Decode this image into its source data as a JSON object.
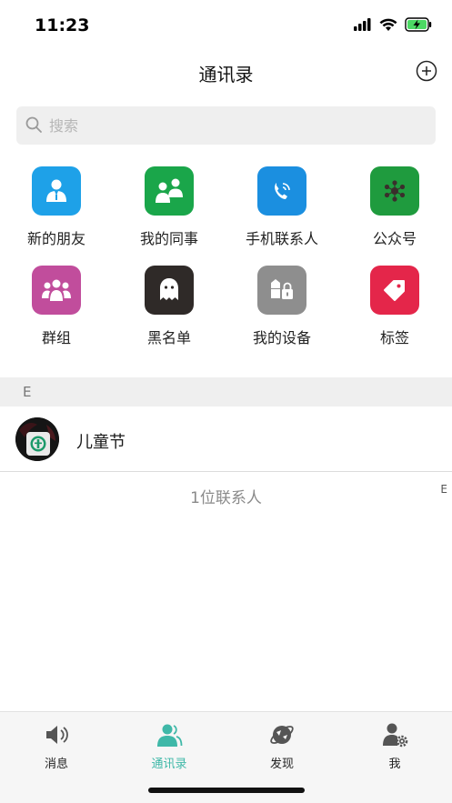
{
  "status": {
    "time": "11:23"
  },
  "header": {
    "title": "通讯录",
    "add_icon": "plus-circle-icon"
  },
  "search": {
    "placeholder": "搜索"
  },
  "grid": [
    {
      "label": "新的朋友",
      "color": "#1ea1e8",
      "icon": "new-friend-icon"
    },
    {
      "label": "我的同事",
      "color": "#1aa64a",
      "icon": "colleagues-icon"
    },
    {
      "label": "手机联系人",
      "color": "#1b8fe0",
      "icon": "phone-contacts-icon"
    },
    {
      "label": "公众号",
      "color": "#1f9b3e",
      "icon": "official-account-icon"
    },
    {
      "label": "群组",
      "color": "#c14d9c",
      "icon": "group-icon"
    },
    {
      "label": "黑名单",
      "color": "#2f2a28",
      "icon": "ghost-icon"
    },
    {
      "label": "我的设备",
      "color": "#8e8e8e",
      "icon": "devices-icon"
    },
    {
      "label": "标签",
      "color": "#e4264a",
      "icon": "tag-icon"
    }
  ],
  "section": {
    "letter": "E"
  },
  "contacts": [
    {
      "name": "儿童节"
    }
  ],
  "count_text": "1位联系人",
  "index_letter": "E",
  "tabs": [
    {
      "label": "消息",
      "icon": "speaker-icon",
      "active": false
    },
    {
      "label": "通讯录",
      "icon": "contacts-icon",
      "active": true
    },
    {
      "label": "发现",
      "icon": "planet-icon",
      "active": false
    },
    {
      "label": "我",
      "icon": "user-settings-icon",
      "active": false
    }
  ],
  "colors": {
    "accent": "#3fb8a8",
    "tab_inactive": "#555555"
  }
}
